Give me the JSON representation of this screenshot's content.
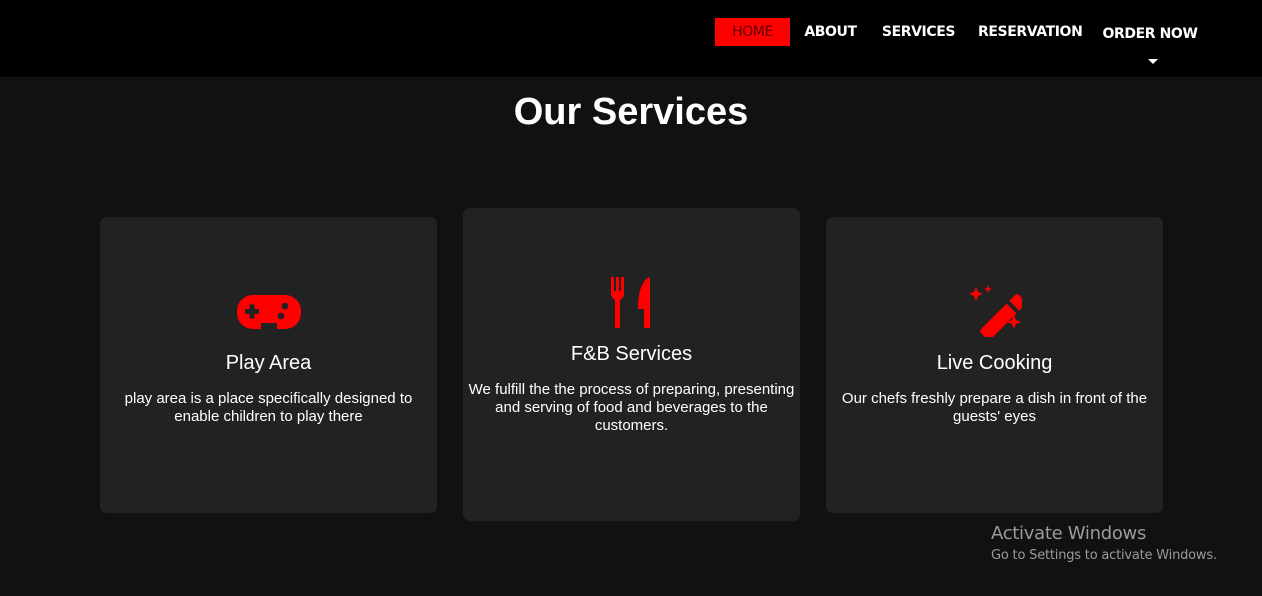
{
  "nav": {
    "items": [
      {
        "label": "HOME"
      },
      {
        "label": "ABOUT"
      },
      {
        "label": "SERVICES"
      },
      {
        "label": "RESERVATION"
      },
      {
        "label": "ORDER NOW"
      }
    ]
  },
  "page": {
    "title": "Our Services"
  },
  "services": [
    {
      "icon": "gamepad-icon",
      "title": "Play Area",
      "description": "play area is a place specifically designed to enable children to play there"
    },
    {
      "icon": "utensils-icon",
      "title": "F&B Services",
      "description": "We fulfill the the process of preparing, presenting and serving of food and beverages to the customers."
    },
    {
      "icon": "magic-wand-icon",
      "title": "Live Cooking",
      "description": "Our chefs freshly prepare a dish in front of the guests' eyes"
    }
  ],
  "watermark": {
    "title": "Activate Windows",
    "subtitle": "Go to Settings to activate Windows."
  },
  "colors": {
    "accent": "#ff0000",
    "background": "#111111",
    "card": "#222222",
    "navbar": "#000000"
  }
}
